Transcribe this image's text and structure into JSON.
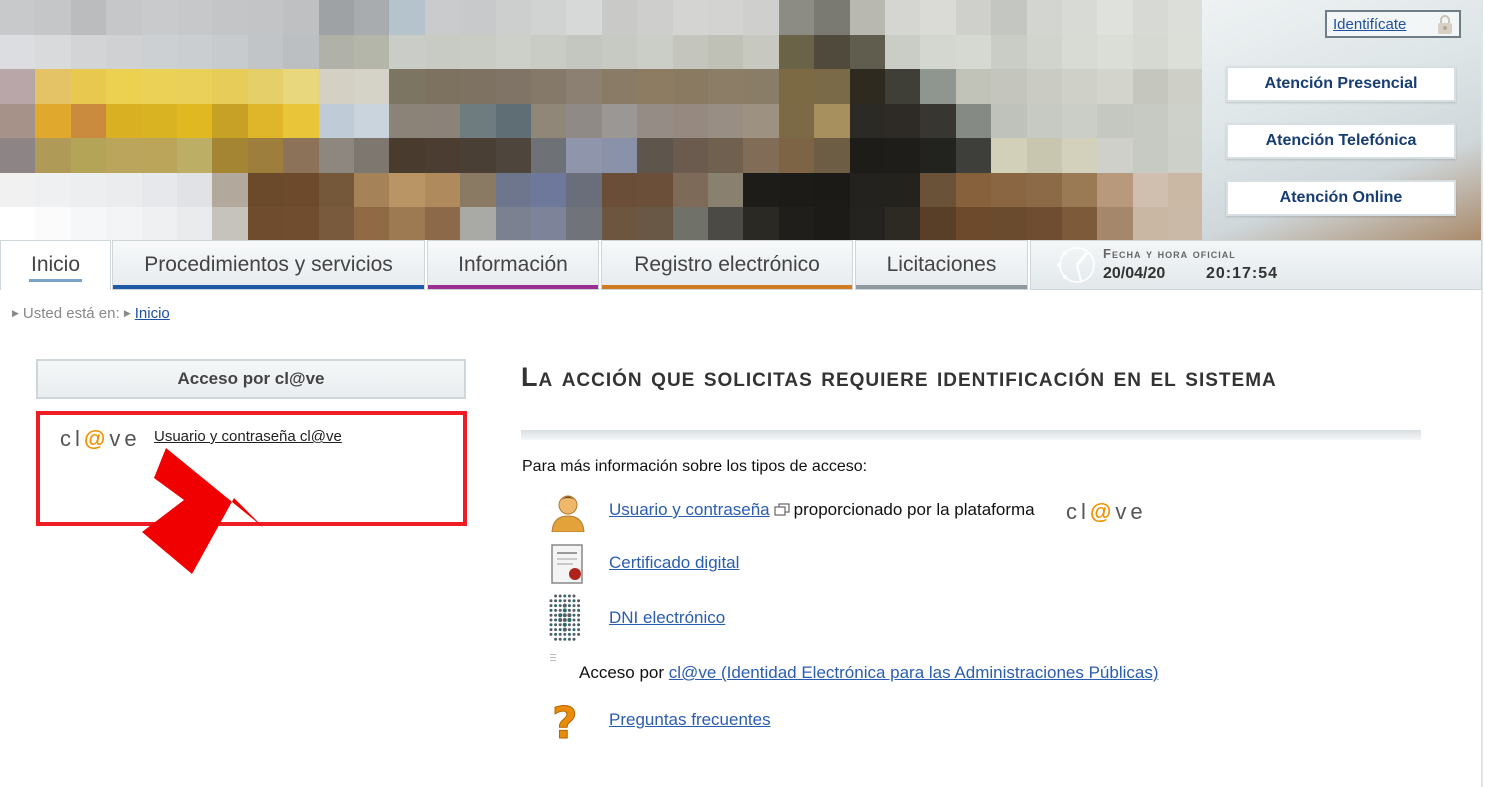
{
  "header": {
    "login_link": "Identifícate",
    "attention_buttons": [
      {
        "label": "Atención Presencial"
      },
      {
        "label": "Atención Telefónica"
      },
      {
        "label": "Atención Online"
      }
    ]
  },
  "nav": {
    "tabs": [
      {
        "label": "Inicio",
        "active": true,
        "color": "#7aa2c8"
      },
      {
        "label": "Procedimientos y servicios",
        "color": "#1f5aa6"
      },
      {
        "label": "Información",
        "color": "#9b2f8f"
      },
      {
        "label": "Registro electrónico",
        "color": "#d07a22"
      },
      {
        "label": "Licitaciones",
        "color": "#8f9aa0"
      }
    ],
    "clock": {
      "title": "Fecha y hora oficial",
      "date": "20/04/20",
      "time": "20:17:54"
    }
  },
  "breadcrumb": {
    "prefix": "Usted está en:",
    "link": "Inicio"
  },
  "left_panel": {
    "heading": "Acceso por cl@ve",
    "clave_logo": "cl@ve",
    "link": "Usuario y contraseña cl@ve"
  },
  "main": {
    "title": "La acción que solicitas requiere identificación en el sistema",
    "intro": "Para más información sobre los tipos de acceso:",
    "items": {
      "user_link": "Usuario y contraseña",
      "user_suffix": "proporcionado por la plataforma",
      "certificate_link": "Certificado digital",
      "dni_link": "DNI electrónico",
      "clave_prefix": "Acceso por",
      "clave_link": "cl@ve (Identidad Electrónica para las Administraciones Públicas)",
      "faq_link": "Preguntas frecuentes"
    }
  },
  "colors": {
    "accent_red": "#ee1c25",
    "link_blue": "#2a5db0",
    "clave_orange": "#f29100"
  }
}
